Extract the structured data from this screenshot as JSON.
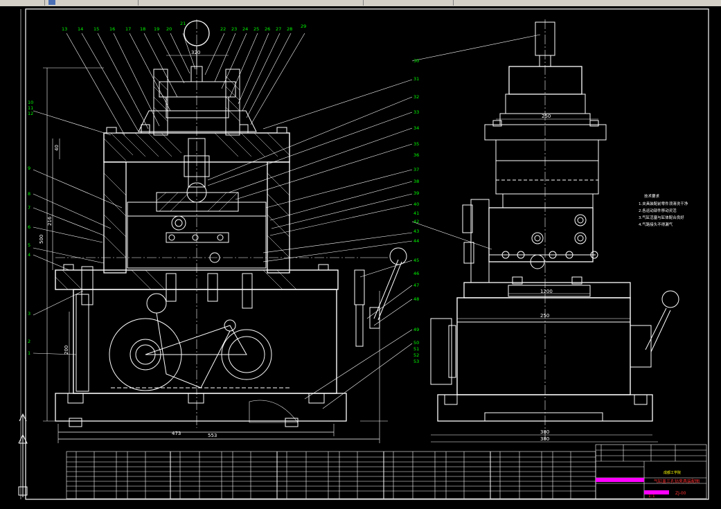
{
  "colors": {
    "background": "#000000",
    "lines": "#ffffff",
    "callouts": "#00ff00",
    "border": "#ffffff",
    "titleblock_text": "#ffff00",
    "titleblock_highlight": "#ff00ff",
    "title_red": "#ff3030"
  },
  "toolbar": {
    "icons": [
      "toolbar-icon",
      "toolbar-icon"
    ]
  },
  "dimensions": {
    "front_overall_width": "553",
    "front_base_width": "473",
    "front_top": "320",
    "front_height_left": "500",
    "front_height_mid": "216",
    "front_height_small": "40",
    "front_height_bottom": "200",
    "side_top": "250",
    "side_mid": "1200",
    "side_base_width": "250",
    "side_overall_width": "380",
    "side_bottom": "380"
  },
  "callouts_top": [
    "13",
    "14",
    "15",
    "16",
    "17",
    "18",
    "19",
    "20",
    "21",
    "22",
    "23",
    "24",
    "25",
    "26",
    "27",
    "28",
    "29"
  ],
  "callouts_left": [
    "10",
    "11",
    "12",
    "9",
    "8",
    "7",
    "6",
    "5",
    "4",
    "3",
    "2",
    "1"
  ],
  "callouts_right": [
    "30",
    "31",
    "32",
    "33",
    "34",
    "35",
    "36",
    "37",
    "38",
    "39",
    "40",
    "41",
    "42",
    "43",
    "44",
    "45",
    "46",
    "47",
    "48",
    "49",
    "50",
    "51",
    "52",
    "53"
  ],
  "technical_notes": {
    "title": "技术要求",
    "lines": [
      "1.夹具装配前零件须清洗干净",
      "2.各运动部件移动灵活",
      "3.气缸活塞与缸体配合良好",
      "4.气路接头不得漏气"
    ]
  },
  "title_block": {
    "school": "成都工学院",
    "drawing_title": "气缸盖三孔钻夹具装配图",
    "drawing_number": "ZJ-00",
    "scale": "1:1"
  }
}
